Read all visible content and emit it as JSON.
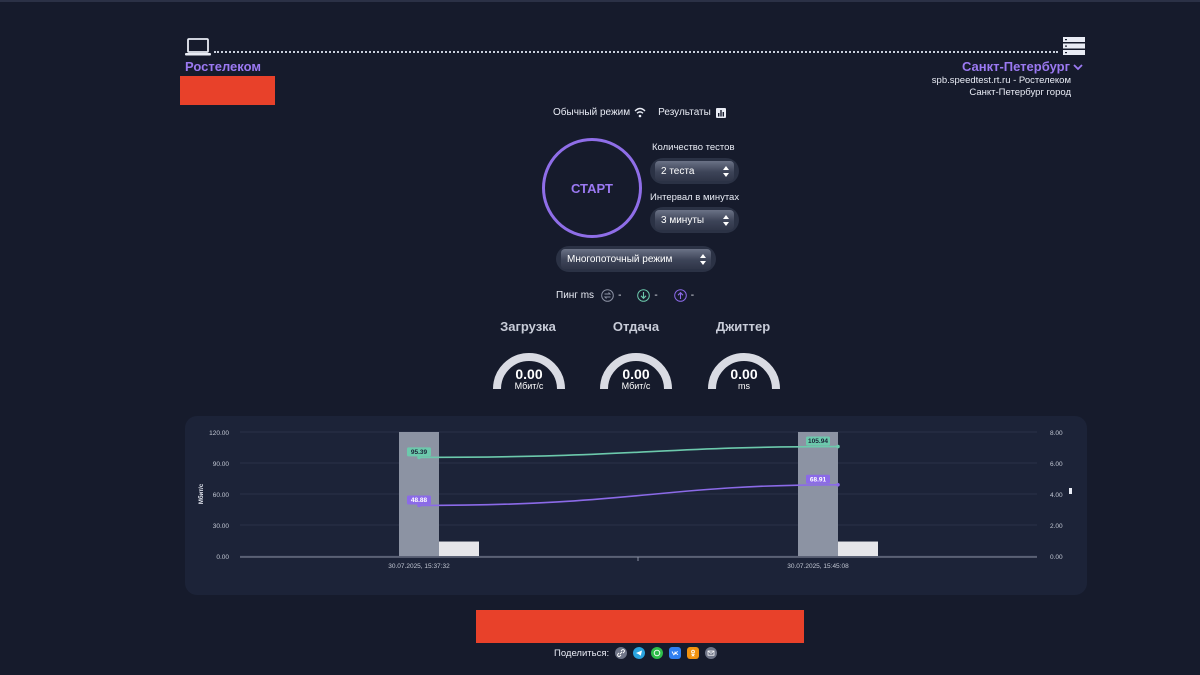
{
  "header": {
    "isp": "Ростелеком",
    "city": "Санкт-Петербург",
    "server_host": "spb.speedtest.rt.ru - Ростелеком",
    "server_city": "Санкт-Петербург город"
  },
  "modes": {
    "normal": "Обычный режим",
    "results": "Результаты"
  },
  "start": {
    "label": "СТАРТ"
  },
  "tests": {
    "label": "Количество тестов",
    "value": "2 теста"
  },
  "interval": {
    "label": "Интервал в минутах",
    "value": "3 минуты"
  },
  "thread_mode": {
    "value": "Многопоточный режим"
  },
  "ping": {
    "label": "Пинг ms",
    "values": [
      "-",
      "-",
      "-"
    ]
  },
  "gauges": [
    {
      "title": "Загрузка",
      "value": "0.00",
      "unit": "Мбит/с"
    },
    {
      "title": "Отдача",
      "value": "0.00",
      "unit": "Мбит/с"
    },
    {
      "title": "Джиттер",
      "value": "0.00",
      "unit": "ms"
    }
  ],
  "share": {
    "label": "Поделиться:"
  },
  "colors": {
    "accent": "#9b79f2",
    "download": "#6cc9ac",
    "upload": "#7a5ce0",
    "brand_red": "#e8412a",
    "background": "#161b2c"
  },
  "chart_data": {
    "type": "line",
    "ylabel_left": "Мбит/с",
    "yticks_left": [
      "0.00",
      "30.00",
      "60.00",
      "90.00",
      "120.00"
    ],
    "ylim_left": [
      0,
      120
    ],
    "yticks_right": [
      "0.00",
      "2.00",
      "4.00",
      "6.00",
      "8.00"
    ],
    "ylim_right": [
      0,
      8
    ],
    "categories": [
      "30.07.2025, 15:37:32",
      "30.07.2025, 15:45:08"
    ],
    "series": [
      {
        "kind": "line",
        "color": "#6cc9ac",
        "values": [
          95.39,
          105.94
        ],
        "labels": [
          "95.39",
          "105.94"
        ]
      },
      {
        "kind": "line",
        "color": "#8b6ae8",
        "values": [
          48.88,
          68.91
        ],
        "labels": [
          "48.88",
          "68.91"
        ]
      },
      {
        "kind": "bar",
        "axis": "left",
        "color": "#8c93a3",
        "values": [
          120,
          120
        ]
      },
      {
        "kind": "bar",
        "axis": "left",
        "color": "#e6e6ea",
        "values": [
          14,
          14
        ]
      }
    ],
    "grid": true
  }
}
